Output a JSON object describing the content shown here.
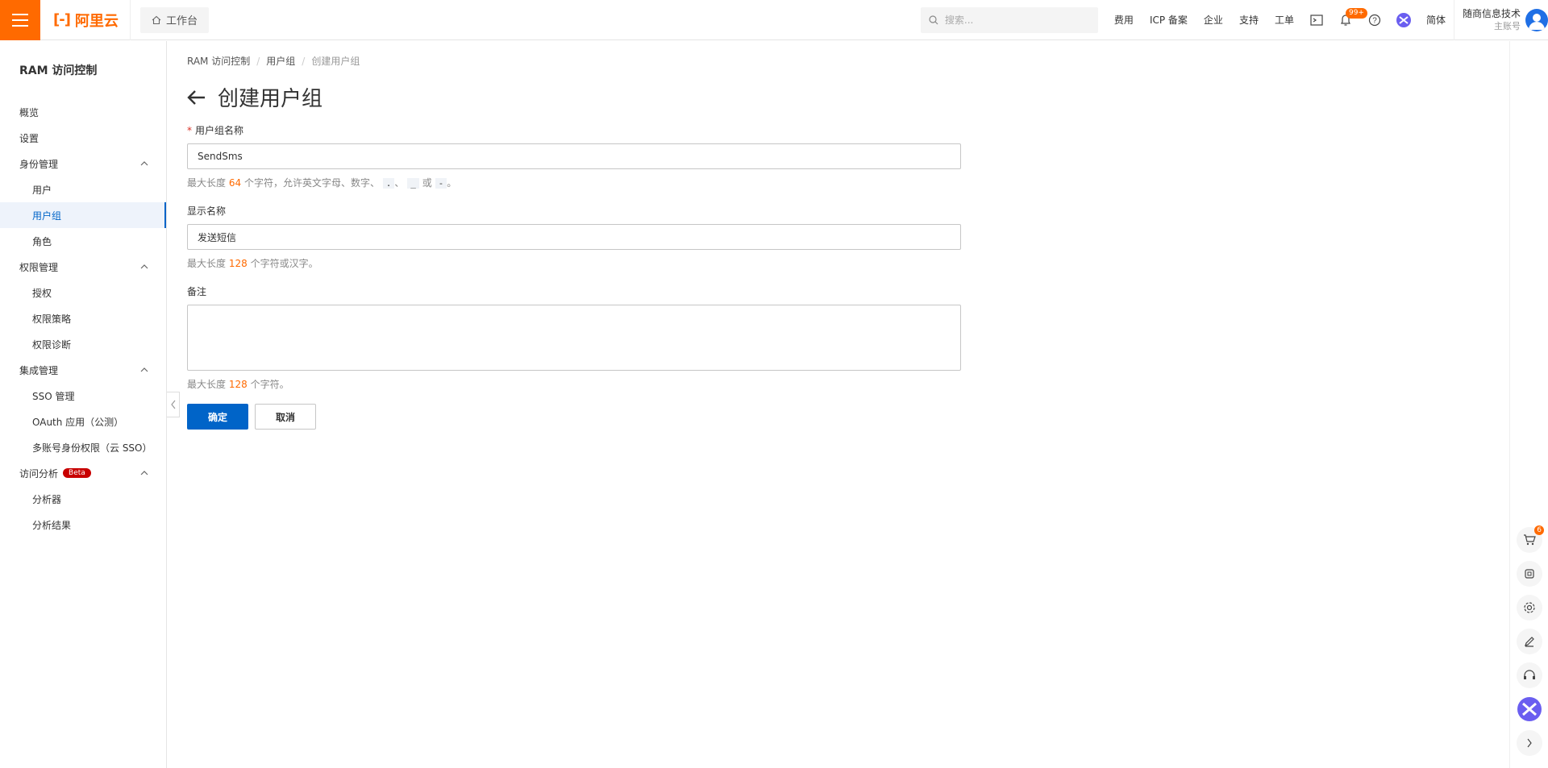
{
  "header": {
    "logo_text": "阿里云",
    "workbench_label": "工作台",
    "search_placeholder": "搜索...",
    "links": [
      "费用",
      "ICP 备案",
      "企业",
      "支持",
      "工单"
    ],
    "notification_badge": "99+",
    "language": "简体",
    "user_name": "随商信息技术",
    "user_sub": "主账号",
    "accent_color": "#ff6a00"
  },
  "sidebar": {
    "title": "RAM 访问控制",
    "items": [
      {
        "label": "概览"
      },
      {
        "label": "设置"
      },
      {
        "label": "身份管理"
      },
      {
        "label": "用户"
      },
      {
        "label": "用户组"
      },
      {
        "label": "角色"
      },
      {
        "label": "权限管理"
      },
      {
        "label": "授权"
      },
      {
        "label": "权限策略"
      },
      {
        "label": "权限诊断"
      },
      {
        "label": "集成管理"
      },
      {
        "label": "SSO 管理"
      },
      {
        "label": "OAuth 应用（公测）"
      },
      {
        "label": "多账号身份权限（云 SSO）"
      },
      {
        "label": "访问分析"
      },
      {
        "label": "分析器"
      },
      {
        "label": "分析结果"
      }
    ],
    "beta_badge": "Beta"
  },
  "breadcrumb": [
    "RAM 访问控制",
    "用户组",
    "创建用户组"
  ],
  "page_title": "创建用户组",
  "form": {
    "group_name_label": "用户组名称",
    "group_name_value": "SendSms",
    "group_name_help_prefix": "最大长度",
    "group_name_help_num": "64",
    "group_name_help_mid": "个字符，允许英文字母、数字、",
    "code_dot": ".",
    "code_underscore": "_",
    "or_text": "或",
    "code_dash": "-",
    "period": "。",
    "sep": "、",
    "display_name_label": "显示名称",
    "display_name_value": "发送短信",
    "display_help_prefix": "最大长度",
    "display_help_num": "128",
    "display_help_suffix": "个字符或汉字。",
    "remark_label": "备注",
    "remark_help_prefix": "最大长度",
    "remark_help_num": "128",
    "remark_help_suffix": "个字符。",
    "confirm_label": "确定",
    "cancel_label": "取消"
  },
  "right_rail": {
    "cart_badge": "6",
    "icons": [
      "cart-icon",
      "chip-icon",
      "settings-icon",
      "edit-icon",
      "headset-icon",
      "assistant-icon",
      "chevron-right-icon"
    ]
  }
}
